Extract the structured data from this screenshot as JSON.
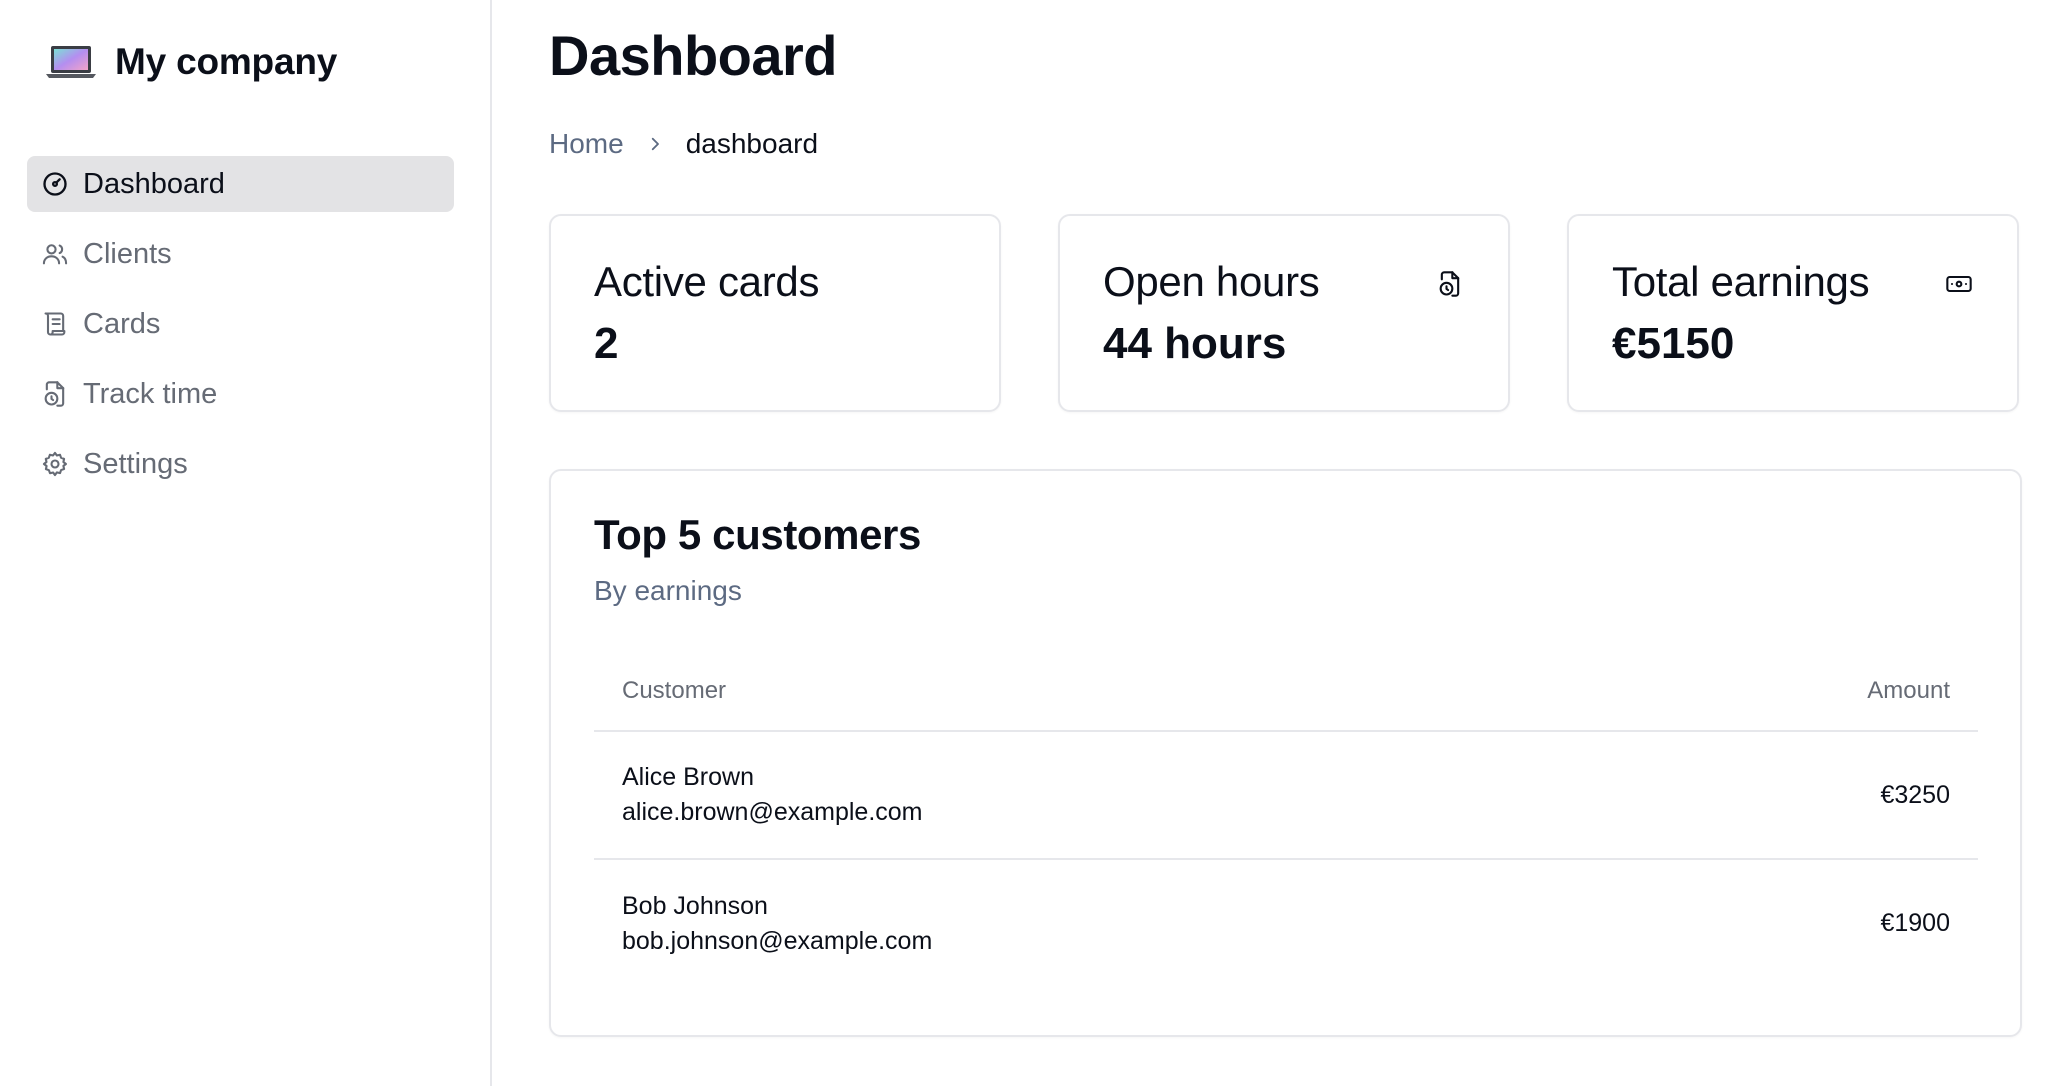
{
  "brand": {
    "name": "My company",
    "icon": "laptop-icon"
  },
  "sidebar": {
    "items": [
      {
        "label": "Dashboard",
        "icon": "gauge-icon",
        "active": true
      },
      {
        "label": "Clients",
        "icon": "users-icon",
        "active": false
      },
      {
        "label": "Cards",
        "icon": "scroll-icon",
        "active": false
      },
      {
        "label": "Track time",
        "icon": "file-clock-icon",
        "active": false
      },
      {
        "label": "Settings",
        "icon": "gear-icon",
        "active": false
      }
    ]
  },
  "page": {
    "title": "Dashboard",
    "breadcrumb": {
      "home": "Home",
      "current": "dashboard"
    }
  },
  "stats": [
    {
      "label": "Active cards",
      "value": "2"
    },
    {
      "label": "Open hours",
      "value": "44 hours",
      "icon": "file-clock-icon"
    },
    {
      "label": "Total earnings",
      "value": "€5150",
      "icon": "banknote-icon"
    }
  ],
  "customers": {
    "title": "Top 5 customers",
    "subtitle": "By earnings",
    "columns": {
      "customer": "Customer",
      "amount": "Amount"
    },
    "rows": [
      {
        "name": "Alice Brown",
        "email": "alice.brown@example.com",
        "amount": "€3250"
      },
      {
        "name": "Bob Johnson",
        "email": "bob.johnson@example.com",
        "amount": "€1900"
      }
    ]
  },
  "colors": {
    "text": "#0b0f19",
    "muted": "#666b75",
    "breadcrumb": "#5c6a82",
    "active_bg": "#e3e3e5",
    "border": "#e6e7eb"
  }
}
